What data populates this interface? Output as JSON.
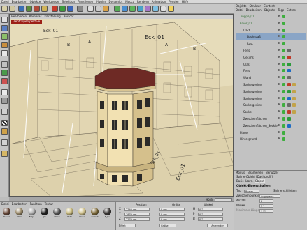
{
  "menubar": [
    "Datei",
    "Bearbeiten",
    "Objekte",
    "Werkzeuge",
    "Selektion",
    "Funktionen",
    "Plugins",
    "Dynamics",
    "Mocca",
    "Rendern",
    "Animation",
    "Fenster",
    "Hilfe"
  ],
  "viewport": {
    "menu": [
      "Bearbeiten",
      "Kameras",
      "Darstellung",
      "Ansicht"
    ],
    "tab": "Zentralperspektive",
    "labels": [
      "Eck_01",
      "B",
      "A",
      "Eck_01",
      "A",
      "B",
      "Eck_01",
      "Eck_01"
    ]
  },
  "timeline": {
    "frame": "90 B"
  },
  "objmgr": {
    "tabs": [
      "Objekte",
      "Struktur",
      "Content"
    ],
    "menu": [
      "Datei",
      "Bearbeiten",
      "Objekte",
      "Tags",
      "Extras"
    ],
    "rows": [
      {
        "label": "Treppe_01",
        "indent": 0
      },
      {
        "label": "Erker_01",
        "indent": 0
      },
      {
        "label": "Dach",
        "indent": 1
      },
      {
        "label": "Dachspaß",
        "indent": 2
      },
      {
        "label": "Rast",
        "indent": 2
      },
      {
        "label": "Fens",
        "indent": 1
      },
      {
        "label": "Gesims",
        "indent": 1
      },
      {
        "label": "Glas",
        "indent": 1
      },
      {
        "label": "Fens",
        "indent": 1
      },
      {
        "label": "Wand",
        "indent": 1
      },
      {
        "label": "Sockelgesims",
        "indent": 1
      },
      {
        "label": "Sockelgesims",
        "indent": 1
      },
      {
        "label": "Sockelgesims",
        "indent": 1
      },
      {
        "label": "Sockelgesims",
        "indent": 1
      },
      {
        "label": "Sockel",
        "indent": 1
      },
      {
        "label": "Zwischenflächen",
        "indent": 1
      },
      {
        "label": "Zwischenflächen_Sockle",
        "indent": 1
      },
      {
        "label": "Plane",
        "indent": 0
      },
      {
        "label": "Hintergrund",
        "indent": 0
      }
    ]
  },
  "attr": {
    "menu": [
      "Modus",
      "Bearbeiten",
      "Benutzer"
    ],
    "title": "Spline-Objekt [Dachprofil]",
    "tabs": [
      "Basis",
      "Koord.",
      "Objekt"
    ],
    "section": "Objekt-Eigenschaften",
    "type_label": "Typ",
    "type_value": "Bezier",
    "closed_label": "Spline schließen",
    "interp_label": "Zwischenpunkte",
    "interp_value": "Angepasst",
    "count_label": "Anzahl",
    "count_value": "8",
    "angle_label": "Winkel",
    "angle_value": "5 °",
    "maxlen_label": "Maximale Länge",
    "maxlen_value": "5 m"
  },
  "materials": {
    "menu": [
      "Datei",
      "Bearbeiten",
      "Funktion",
      "Textur"
    ],
    "items": [
      {
        "label": "Dachr",
        "color": "#6a4a3a"
      },
      {
        "label": "Matr",
        "color": "#9a8a6a"
      },
      {
        "label": "Edge",
        "color": "#b0b0b0"
      },
      {
        "label": "gla",
        "color": "#222"
      },
      {
        "label": "Hand",
        "color": "#5a5a5a"
      },
      {
        "label": "Putz",
        "color": "#c7b97e"
      },
      {
        "label": "Wand",
        "color": "#cdbf8a"
      },
      {
        "label": "Zwisch",
        "color": "#7d6a3a"
      },
      {
        "label": "E_Pu",
        "color": "#3d3a38"
      }
    ]
  },
  "coords": {
    "headers": [
      "Position",
      "Größe",
      "Winkel"
    ],
    "rows": [
      {
        "axis": "X",
        "pos": "2240 cm",
        "size": "0 cm",
        "ang_lbl": "H",
        "ang": "0 °"
      },
      {
        "axis": "Y",
        "pos": "1970 cm",
        "size": "0 cm",
        "ang_lbl": "P",
        "ang": "0 °"
      },
      {
        "axis": "Z",
        "pos": "2270 cm",
        "size": "0 cm",
        "ang_lbl": "B",
        "ang": "0 °"
      }
    ],
    "mode1": "Welt",
    "mode2": "Größe",
    "apply": "Anwenden"
  }
}
